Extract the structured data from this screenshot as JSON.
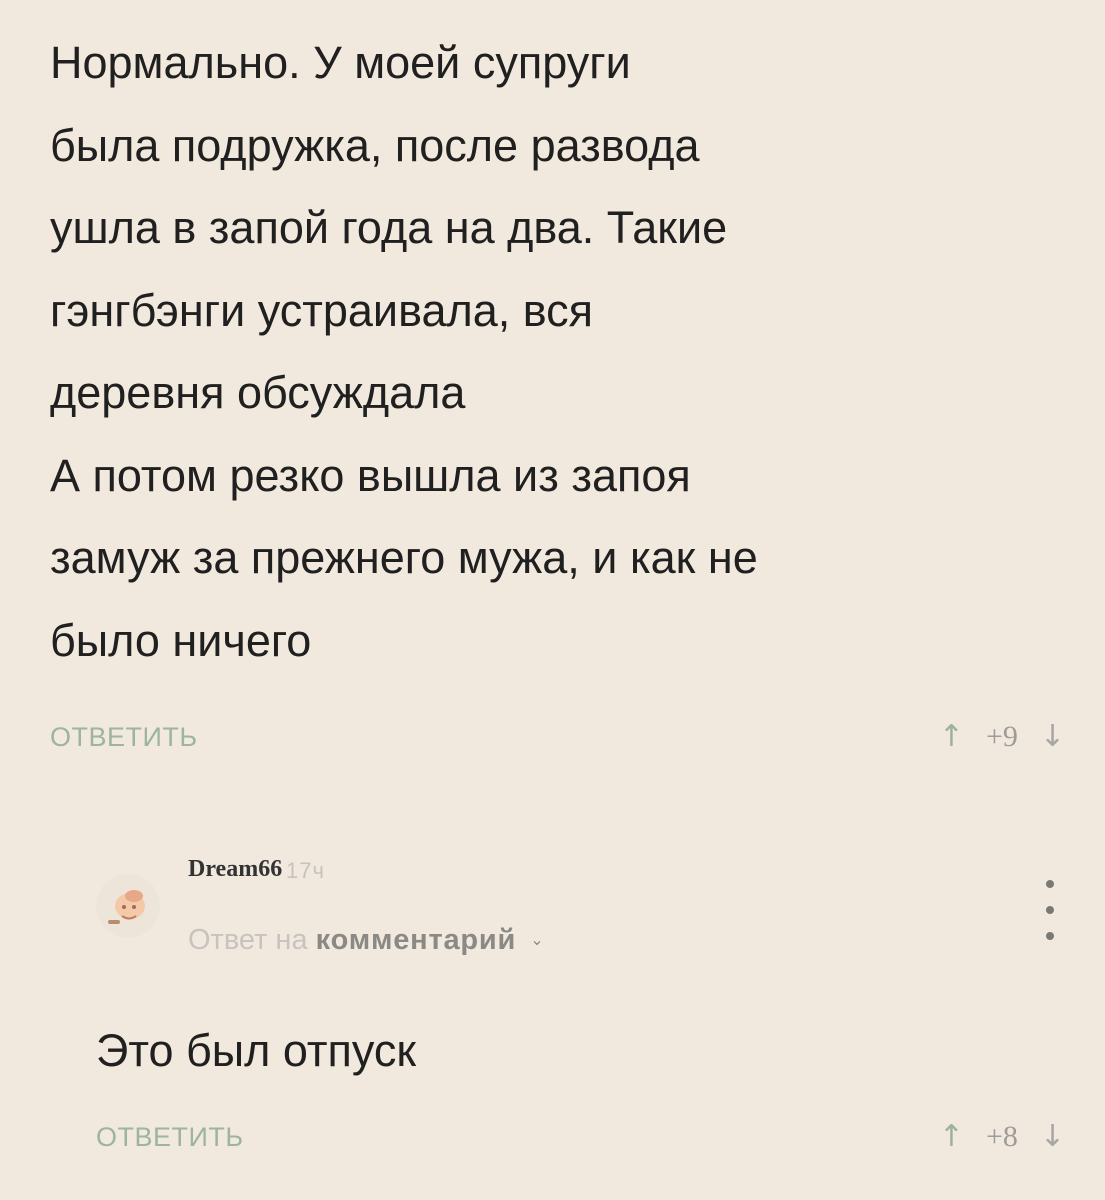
{
  "comment": {
    "lines": [
      "Нормально. У моей супруги",
      "была подружка, после развода",
      "ушла в запой года на два. Такие",
      "гэнгбэнги устраивала, вся",
      "деревня обсуждала",
      "А потом резко вышла из запоя",
      "замуж за прежнего мужа, и как не",
      "было ничего"
    ],
    "reply_label": "ОТВЕТИТЬ",
    "up_arrow": "↑",
    "score": "+9",
    "down_arrow": "↓"
  },
  "reply": {
    "username": "Dream66",
    "time": "17ч",
    "reply_to_prefix": "Ответ на",
    "reply_to_target": "комментарий",
    "chevron": "⌄",
    "text": "Это был отпуск",
    "reply_label": "ОТВЕТИТЬ",
    "up_arrow": "↑",
    "score": "+8",
    "down_arrow": "↓"
  },
  "icons": {
    "avatar": "avatar-icon",
    "menu": "more-vertical-icon",
    "upvote": "arrow-up-icon",
    "downvote": "arrow-down-icon"
  },
  "colors": {
    "background": "#f2e9de",
    "reply_link": "#9db4a0",
    "vote_up": "#9bb39c",
    "muted_text": "#c7c3bf"
  }
}
